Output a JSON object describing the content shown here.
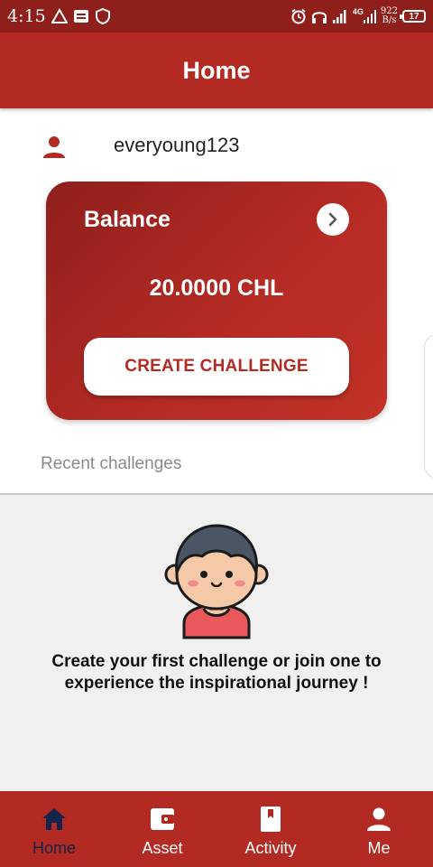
{
  "status_bar": {
    "time": "4:15",
    "network_label": "4G",
    "speed_value": "922",
    "speed_unit": "B/s",
    "battery": "17"
  },
  "app_bar": {
    "title": "Home"
  },
  "user": {
    "username": "everyoung123"
  },
  "balance_card": {
    "label": "Balance",
    "value": "20.0000 CHL",
    "create_button": "CREATE CHALLENGE"
  },
  "recent": {
    "label": "Recent challenges"
  },
  "empty_state": {
    "message": "Create your first challenge or join one to experience the inspirational journey !"
  },
  "bottom_nav": {
    "items": [
      {
        "label": "Home",
        "icon": "home-icon",
        "active": true
      },
      {
        "label": "Asset",
        "icon": "wallet-icon",
        "active": false
      },
      {
        "label": "Activity",
        "icon": "book-icon",
        "active": false
      },
      {
        "label": "Me",
        "icon": "person-icon",
        "active": false
      }
    ]
  },
  "colors": {
    "primary": "#b32a22",
    "status_bar": "#8e1f1b",
    "active_nav": "#15244a",
    "empty_bg": "#f0f0f0"
  }
}
